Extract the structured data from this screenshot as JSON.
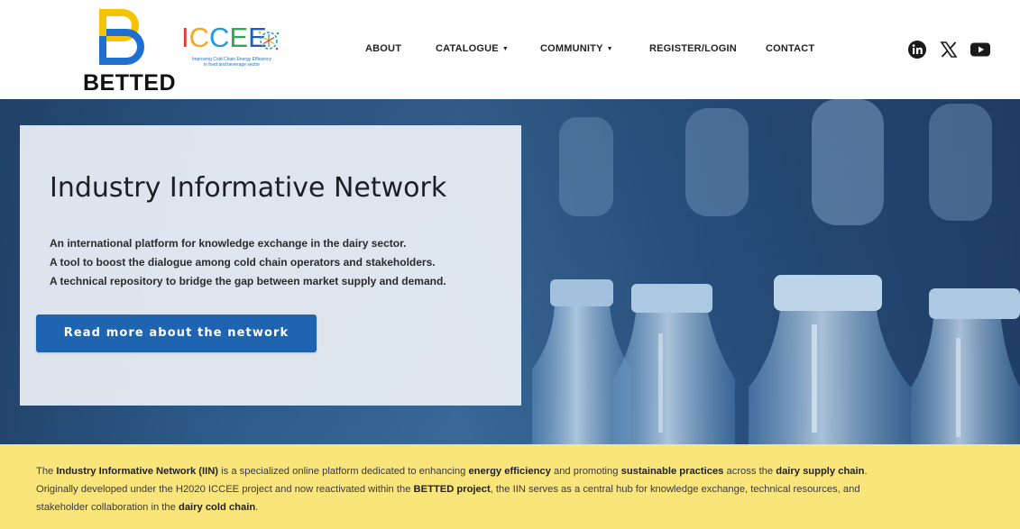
{
  "header": {
    "logo_betted": {
      "text": "BETTED",
      "icon": "betted-b-logo-icon"
    },
    "logo_iccee": {
      "word_letters": [
        "I",
        "C",
        "C",
        "E",
        "E"
      ],
      "letter_colors": [
        "#e53935",
        "#f5a623",
        "#1f9bd8",
        "#2fa84f",
        "#1f5fb8"
      ],
      "tagline_line1": "Improving Cold Chain Energy Efficiency",
      "tagline_line2": "in food and beverage sector",
      "icon": "snowflake-gear-icon"
    },
    "nav": [
      {
        "label": "ABOUT",
        "dropdown": false
      },
      {
        "label": "CATALOGUE",
        "dropdown": true
      },
      {
        "label": "COMMUNITY",
        "dropdown": true
      },
      {
        "label": "REGISTER/LOGIN",
        "dropdown": false
      },
      {
        "label": "CONTACT",
        "dropdown": false
      }
    ],
    "social": [
      "linkedin-icon",
      "x-icon",
      "youtube-icon"
    ]
  },
  "hero": {
    "title": "Industry Informative Network",
    "lines": [
      "An international platform for knowledge exchange in the dairy sector.",
      "A tool to boost the dialogue among cold chain operators and stakeholders.",
      "A technical repository to bridge the gap between market supply and demand."
    ],
    "button_label": "Read more about the network",
    "button_color": "#1f64b1",
    "background_image": "dairy-bottles-production-line"
  },
  "intro": {
    "background_color": "#fae57a",
    "line1": [
      {
        "text": "The ",
        "bold": false
      },
      {
        "text": "Industry Informative Network (IIN)",
        "bold": true
      },
      {
        "text": " is a specialized online platform dedicated to enhancing ",
        "bold": false
      },
      {
        "text": "energy efficiency",
        "bold": true
      },
      {
        "text": " and promoting ",
        "bold": false
      },
      {
        "text": "sustainable practices",
        "bold": true
      },
      {
        "text": " across the ",
        "bold": false
      },
      {
        "text": "dairy supply chain",
        "bold": true
      },
      {
        "text": ".",
        "bold": false
      }
    ],
    "line2": [
      {
        "text": "Originally developed under the H2020 ICCEE project and now reactivated within the ",
        "bold": false
      },
      {
        "text": "BETTED project",
        "bold": true
      },
      {
        "text": ", the IIN serves as a central hub for knowledge exchange, technical resources, and",
        "bold": false
      }
    ],
    "line3": [
      {
        "text": "stakeholder collaboration in the ",
        "bold": false
      },
      {
        "text": "dairy cold chain",
        "bold": true
      },
      {
        "text": ".",
        "bold": false
      }
    ]
  }
}
